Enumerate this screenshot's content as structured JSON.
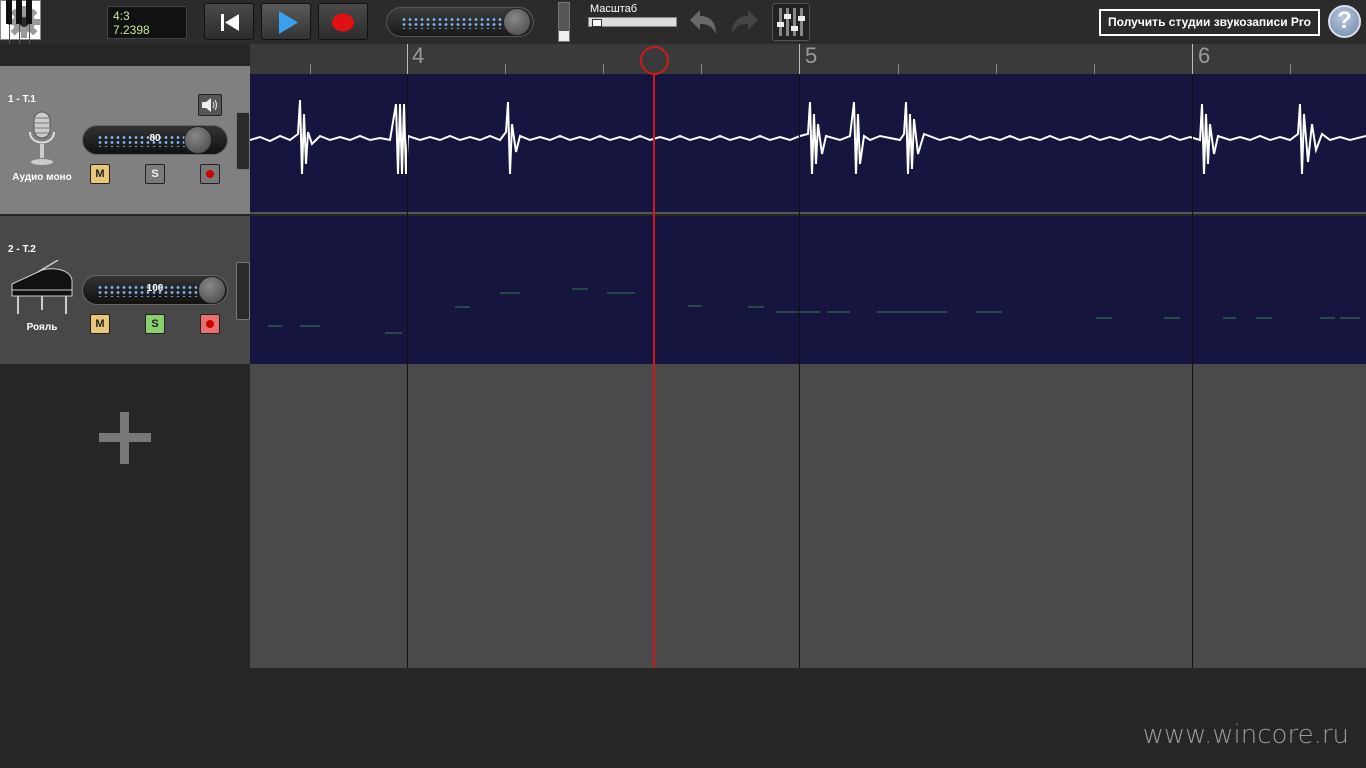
{
  "toolbar": {
    "time_signature": "4:3",
    "time_position": "7.2398",
    "zoom_label": "Масштаб",
    "get_pro_label": "Получить студии звукозаписи Pro",
    "help_label": "?"
  },
  "ruler": {
    "bars": [
      "4",
      "5",
      "6"
    ]
  },
  "tracks": [
    {
      "name": "1 - T.1",
      "type": "Аудио моно",
      "volume": "80",
      "mute": "M",
      "solo": "S"
    },
    {
      "name": "2 - T.2",
      "type": "Рояль",
      "volume": "100",
      "mute": "M",
      "solo": "S"
    }
  ],
  "watermark": "www.wincore.ru",
  "colors": {
    "lane_bg": "#151540",
    "playhead": "#d01a1a",
    "waveform": "#ffffff",
    "midi_notes": "#2e5a4c"
  }
}
